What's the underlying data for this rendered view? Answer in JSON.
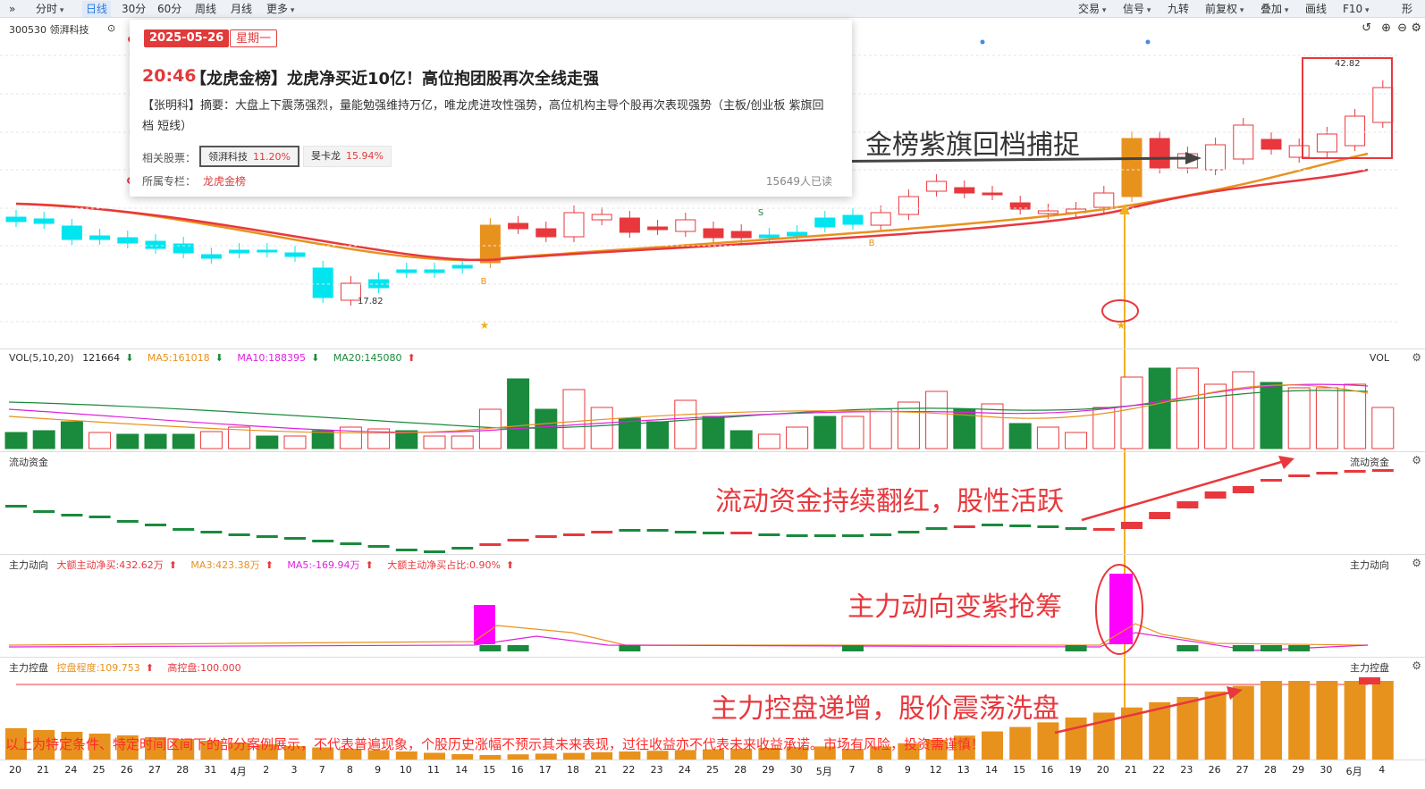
{
  "toolbar": {
    "left_tabs": [
      "分时",
      "日线",
      "30分",
      "60分",
      "周线",
      "月线",
      "更多"
    ],
    "active_tab": "日线",
    "right_menus": [
      "交易",
      "信号",
      "九转",
      "前复权",
      "叠加",
      "画线",
      "F10",
      "形"
    ]
  },
  "stock": {
    "code_name": "300530 领湃科技"
  },
  "popup": {
    "date": "2025-05-26",
    "weekday": "星期一",
    "time": "20:46",
    "title": "【龙虎金榜】龙虎净买近10亿！高位抱团股再次全线走强",
    "summary": "【张明科】摘要：大盘上下震荡强烈，量能勉强维持万亿，唯龙虎进攻性强势，高位机构主导个股再次表现强势（主板/创业板 紫旗回档 短线）",
    "related_label": "相关股票：",
    "related_stocks": [
      {
        "name": "领湃科技",
        "pct": "11.20%"
      },
      {
        "name": "旻卡龙",
        "pct": "15.94%"
      }
    ],
    "column_label": "所属专栏：",
    "column_name": "龙虎金榜",
    "read_count": "15649人已读"
  },
  "price_labels": {
    "low": "17.82",
    "high": "42.82"
  },
  "volume": {
    "title": "VOL(5,10,20)",
    "value": "121664",
    "ma5": "MA5:161018",
    "ma10": "MA10:188395",
    "ma20": "MA20:145080",
    "right_label": "VOL"
  },
  "liquidity": {
    "title": "流动资金",
    "right_label": "流动资金"
  },
  "main_force": {
    "title": "主力动向",
    "net_buy": "大额主动净买:432.62万",
    "ma3": "MA3:423.38万",
    "ma5": "MA5:-169.94万",
    "ratio": "大额主动净买占比:0.90%",
    "right_label": "主力动向"
  },
  "control": {
    "title": "主力控盘",
    "degree": "控盘程度:109.753",
    "high": "高控盘:100.000",
    "right_label": "主力控盘"
  },
  "annotations": {
    "gold": "金榜紫旗回档捕捉",
    "liquidity": "流动资金持续翻红，股性活跃",
    "main_force": "主力动向变紫抢筹",
    "control": "主力控盘递增，股价震荡洗盘"
  },
  "disclaimer": "以上为特定条件、特定时间区间下的部分案例展示，不代表普遍现象，个股历史涨幅不预示其未来表现，过往收益亦不代表未来收益承诺。市场有风险，投资需谨慎！",
  "x_axis": [
    "20",
    "21",
    "24",
    "25",
    "26",
    "27",
    "28",
    "31",
    "4月",
    "2",
    "3",
    "7",
    "8",
    "9",
    "10",
    "11",
    "14",
    "15",
    "16",
    "17",
    "18",
    "21",
    "22",
    "23",
    "24",
    "25",
    "28",
    "29",
    "30",
    "5月",
    "7",
    "8",
    "9",
    "12",
    "13",
    "14",
    "15",
    "16",
    "19",
    "20",
    "21",
    "22",
    "23",
    "26",
    "27",
    "28",
    "29",
    "30",
    "6月",
    "4"
  ],
  "colors": {
    "up": "#e8383d",
    "down": "#1a8a3c",
    "up_cyan": "#00e5f0",
    "accent": "#e03b3b",
    "ma_orange": "#e8921e",
    "ma_red": "#e8383d"
  }
}
